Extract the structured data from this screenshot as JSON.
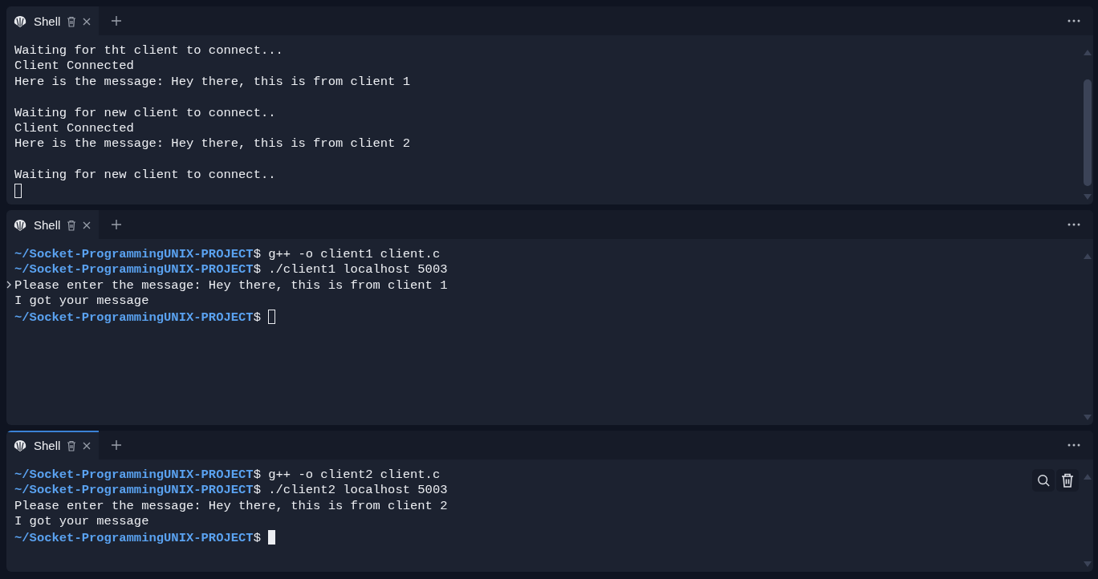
{
  "panes": [
    {
      "tab": {
        "label": "Shell",
        "selected": false
      },
      "scrollbar": true,
      "actions": false,
      "cursor": {
        "filled": false
      },
      "lines": [
        {
          "kind": "output",
          "text": "Waiting for tht client to connect..."
        },
        {
          "kind": "output",
          "text": "Client Connected"
        },
        {
          "kind": "output",
          "text": "Here is the message: Hey there, this is from client 1"
        },
        {
          "kind": "blank"
        },
        {
          "kind": "output",
          "text": "Waiting for new client to connect.."
        },
        {
          "kind": "output",
          "text": "Client Connected"
        },
        {
          "kind": "output",
          "text": "Here is the message: Hey there, this is from client 2"
        },
        {
          "kind": "blank"
        },
        {
          "kind": "output",
          "text": "Waiting for new client to connect.."
        },
        {
          "kind": "cursor"
        }
      ]
    },
    {
      "tab": {
        "label": "Shell",
        "selected": false
      },
      "scrollbar": false,
      "actions": false,
      "cursor": {
        "filled": false
      },
      "lines": [
        {
          "kind": "command",
          "prompt": "~/Socket-ProgrammingUNIX-PROJECT",
          "text": "$ g++ -o client1 client.c"
        },
        {
          "kind": "command",
          "prompt": "~/Socket-ProgrammingUNIX-PROJECT",
          "text": "$ ./client1 localhost 5003"
        },
        {
          "kind": "output",
          "text": "Please enter the message: Hey there, this is from client 1",
          "marked": true
        },
        {
          "kind": "output",
          "text": "I got your message"
        },
        {
          "kind": "prompt",
          "prompt": "~/Socket-ProgrammingUNIX-PROJECT",
          "text": "$"
        }
      ]
    },
    {
      "tab": {
        "label": "Shell",
        "selected": true
      },
      "scrollbar": false,
      "actions": true,
      "cursor": {
        "filled": true
      },
      "lines": [
        {
          "kind": "command",
          "prompt": "~/Socket-ProgrammingUNIX-PROJECT",
          "text": "$ g++ -o client2 client.c"
        },
        {
          "kind": "command",
          "prompt": "~/Socket-ProgrammingUNIX-PROJECT",
          "text": "$ ./client2 localhost 5003"
        },
        {
          "kind": "output",
          "text": "Please enter the message: Hey there, this is from client 2"
        },
        {
          "kind": "output",
          "text": "I got your message"
        },
        {
          "kind": "prompt",
          "prompt": "~/Socket-ProgrammingUNIX-PROJECT",
          "text": "$"
        }
      ]
    }
  ]
}
